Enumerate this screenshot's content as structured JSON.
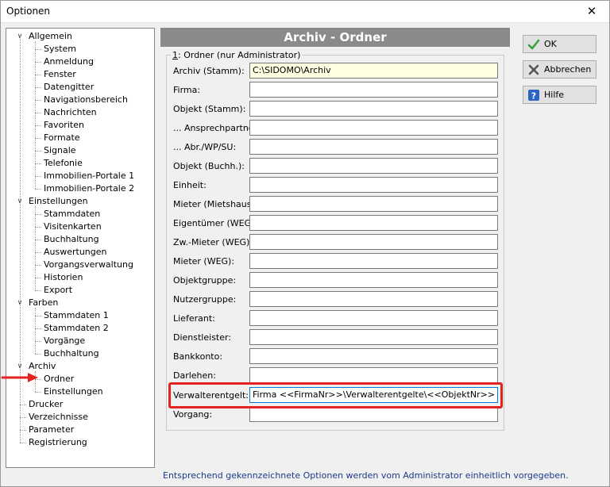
{
  "window": {
    "title": "Optionen",
    "close_glyph": "✕"
  },
  "tree": {
    "groups": [
      {
        "label": "Allgemein",
        "children": [
          "System",
          "Anmeldung",
          "Fenster",
          "Datengitter",
          "Navigationsbereich",
          "Nachrichten",
          "Favoriten",
          "Formate",
          "Signale",
          "Telefonie",
          "Immobilien-Portale 1",
          "Immobilien-Portale 2"
        ]
      },
      {
        "label": "Einstellungen",
        "children": [
          "Stammdaten",
          "Visitenkarten",
          "Buchhaltung",
          "Auswertungen",
          "Vorgangsverwaltung",
          "Historien",
          "Export"
        ]
      },
      {
        "label": "Farben",
        "children": [
          "Stammdaten 1",
          "Stammdaten 2",
          "Vorgänge",
          "Buchhaltung"
        ]
      },
      {
        "label": "Archiv",
        "children": [
          "Ordner",
          "Einstellungen"
        ]
      }
    ],
    "top_items": [
      "Drucker",
      "Verzeichnisse",
      "Parameter",
      "Registrierung"
    ],
    "selected": "Ordner"
  },
  "panel": {
    "header": "Archiv - Ordner",
    "group_number": "1",
    "group_title": ": Ordner  (nur Administrator)",
    "fields": [
      {
        "label": "Archiv (Stamm):",
        "value": "C:\\SIDOMO\\Archiv",
        "style": "yellow"
      },
      {
        "label": "Firma:",
        "value": ""
      },
      {
        "label": "Objekt (Stamm):",
        "value": ""
      },
      {
        "label": "... Ansprechpartner:",
        "value": ""
      },
      {
        "label": "... Abr./WP/SU:",
        "value": ""
      },
      {
        "label": "Objekt (Buchh.):",
        "value": ""
      },
      {
        "label": "Einheit:",
        "value": ""
      },
      {
        "label": "Mieter (Mietshaus):",
        "value": ""
      },
      {
        "label": "Eigentümer (WEG):",
        "value": ""
      },
      {
        "label": "Zw.-Mieter (WEG):",
        "value": ""
      },
      {
        "label": "Mieter (WEG):",
        "value": ""
      },
      {
        "label": "Objektgruppe:",
        "value": ""
      },
      {
        "label": "Nutzergruppe:",
        "value": ""
      },
      {
        "label": "Lieferant:",
        "value": ""
      },
      {
        "label": "Dienstleister:",
        "value": ""
      },
      {
        "label": "Bankkonto:",
        "value": ""
      },
      {
        "label": "Darlehen:",
        "value": ""
      },
      {
        "label": "Verwalterentgelt:",
        "value": "Firma <<FirmaNr>>\\Verwalterentgelte\\<<ObjektNr>> <<ObjektStra",
        "style": "focused"
      },
      {
        "label": "Vorgang:",
        "value": ""
      }
    ]
  },
  "buttons": {
    "ok": "OK",
    "cancel": "Abbrechen",
    "help": "Hilfe"
  },
  "colors": {
    "highlight": "#e3231f",
    "accent_focus": "#0078d7",
    "note_text": "#1a3a8a"
  },
  "footer_note": "Entsprechend gekennzeichnete Optionen werden vom Administrator einheitlich vorgegeben."
}
